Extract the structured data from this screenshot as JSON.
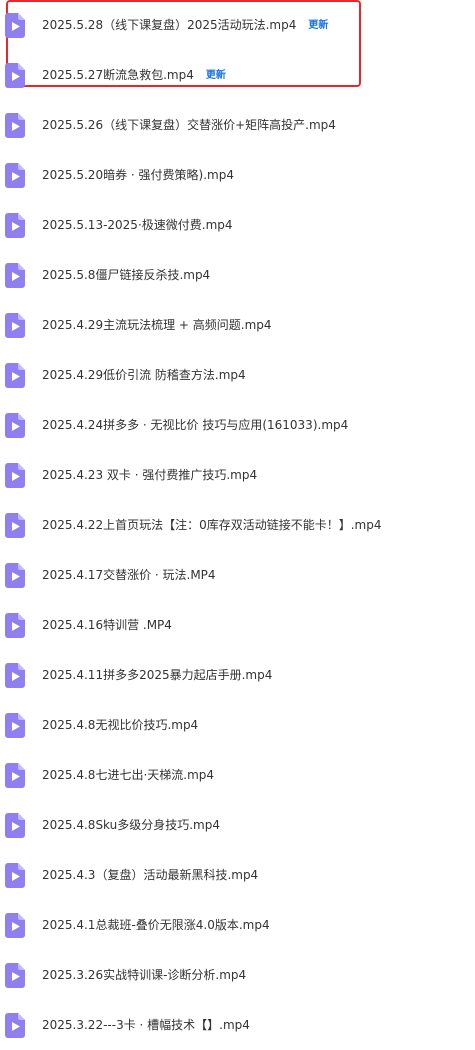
{
  "colors": {
    "icon": "#8f7ff0",
    "text": "#333333",
    "badge": "#1a73e8",
    "highlight": "#e5282b"
  },
  "file_icon": "video-file-icon",
  "files": [
    {
      "name": "2025.5.28（线下课复盘）2025活动玩法.mp4",
      "badge": "更新"
    },
    {
      "name": "2025.5.27断流急救包.mp4",
      "badge": "更新"
    },
    {
      "name": "2025.5.26（线下课复盘）交替涨价+矩阵高投产.mp4"
    },
    {
      "name": "2025.5.20暗券 · 强付费策略).mp4"
    },
    {
      "name": "2025.5.13-2025·极速微付费.mp4"
    },
    {
      "name": "2025.5.8僵尸链接反杀技.mp4"
    },
    {
      "name": "2025.4.29主流玩法梳理 + 高频问题.mp4"
    },
    {
      "name": "2025.4.29低价引流 防稽查方法.mp4"
    },
    {
      "name": "2025.4.24拼多多 · 无视比价 技巧与应用(161033).mp4"
    },
    {
      "name": "2025.4.23 双卡 · 强付费推广技巧.mp4"
    },
    {
      "name": "2025.4.22上首页玩法【注：0库存双活动链接不能卡！】.mp4"
    },
    {
      "name": "2025.4.17交替涨价 · 玩法.MP4"
    },
    {
      "name": "2025.4.16特训营 .MP4"
    },
    {
      "name": "2025.4.11拼多多2025暴力起店手册.mp4"
    },
    {
      "name": "2025.4.8无视比价技巧.mp4"
    },
    {
      "name": "2025.4.8七进七出·天梯流.mp4"
    },
    {
      "name": "2025.4.8Sku多级分身技巧.mp4"
    },
    {
      "name": "2025.4.3（复盘）活动最新黑科技.mp4"
    },
    {
      "name": "2025.4.1总裁班-叠价无限涨4.0版本.mp4"
    },
    {
      "name": "2025.3.26实战特训课-诊断分析.mp4"
    },
    {
      "name": "2025.3.22---3卡 · 槽幅技术【】.mp4"
    }
  ]
}
